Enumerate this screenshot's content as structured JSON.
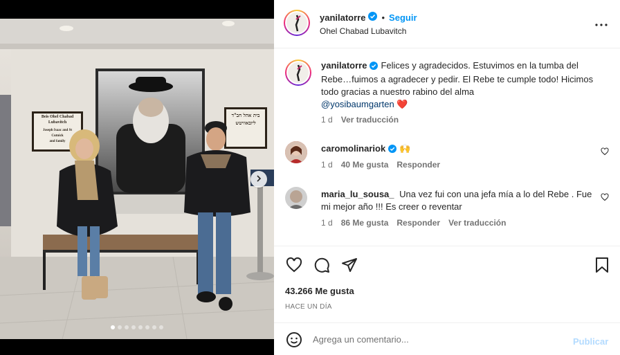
{
  "post": {
    "username": "yanilatorre",
    "follow_label": "Seguir",
    "separator": "•",
    "location": "Ohel Chabad Lubavitch",
    "more_icon": "more-horizontal-icon"
  },
  "caption": {
    "username": "yanilatorre",
    "text": "Felices y agradecidos. Estuvimos en la tumba del Rebe…fuimos a agradecer y pedir. El Rebe te cumple todo! Hicimos todo gracias a nuestro rabino del alma",
    "mention": "@yosibaumgarten",
    "emoji": "❤️",
    "time": "1 d",
    "translate_label": "Ver traducción"
  },
  "comments": [
    {
      "username": "caromolinariok",
      "verified": true,
      "text": "🙌",
      "time": "1 d",
      "likes": "40 Me gusta",
      "reply_label": "Responder",
      "translate_label": ""
    },
    {
      "username": "maria_lu_sousa_",
      "verified": false,
      "text": "Una vez fui con una jefa mía a lo del Rebe . Fue mi mejor año !!! Es creer o reventar",
      "time": "1 d",
      "likes": "86 Me gusta",
      "reply_label": "Responder",
      "translate_label": "Ver traducción"
    }
  ],
  "stats": {
    "likes": "43.266 Me gusta",
    "posted": "HACE UN DÍA"
  },
  "composer": {
    "placeholder": "Agrega un comentario...",
    "publish_label": "Publicar"
  },
  "media": {
    "sign_left": [
      "Beis Ohel Chabad",
      "Lubavitch",
      "Joseph Isaac and St",
      "Cutnick",
      "and family"
    ],
    "sign_right_hebrew": [
      "בית אהל חב\"ד",
      "ליובאוויטש"
    ],
    "carousel_count": 8,
    "carousel_active": 0
  },
  "colors": {
    "accent": "#0095f6",
    "verified": "#0095f6",
    "heart": "#ed4956"
  }
}
